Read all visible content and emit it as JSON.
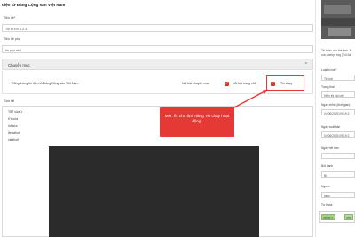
{
  "page": {
    "header": "điện tử Đảng Cộng sản Việt Nam"
  },
  "form": {
    "title_label": "Tiêu đề*",
    "title_value": "Tin tự ĐV 1.2.3",
    "subtitle_label": "Tiêu đề phụ",
    "subtitle_value": "tin phụ abd"
  },
  "category": {
    "section_label": "Chuyên mục",
    "item": "Cổng thông tin điện tử Đảng Cộng sản Việt Nam",
    "featured_label": "Nổi bật chuyên mục",
    "home_featured_label": "Nổi bật trang chủ",
    "hot_label": "Tin chạy"
  },
  "tags": {
    "label": "Tóm tắt",
    "items": [
      "TBT sửa 1",
      "KY sửa",
      "hđ sửa",
      "ẳefsdfsdf",
      "sfsdfsdf"
    ]
  },
  "tooltip": {
    "text": "MM: fix cho tính năng Tin chạy hoạt động."
  },
  "sidebar": {
    "note_line1": "Tệ hoặc vào thẻ ảnh. Đ",
    "note_line2": "con, webp, svg (Tối đa",
    "type_label": "Loại tin bài*",
    "type_value": "Tin bài",
    "status_label": "Trạng thái",
    "status_value": "Hiển thị bài viết",
    "created_label": "Ngày chỉnh (thời gian)",
    "created_value": "04/06/2025 09:19:2",
    "published_label": "Ngày xuất bản",
    "published_value": "04/06/2025 09:19:2",
    "date_label": "Ngày hết hạn",
    "author_label": "Bút danh",
    "author_value": "B0",
    "source_label": "Nguồn",
    "source_value": "ssss",
    "keywords_label": "Từ khóa",
    "keywords": [
      "mmm ×",
      "mm"
    ]
  },
  "colors": {
    "accent": "#e53935",
    "chip": "#a8d08d",
    "video_bg": "#2b2b2b"
  }
}
